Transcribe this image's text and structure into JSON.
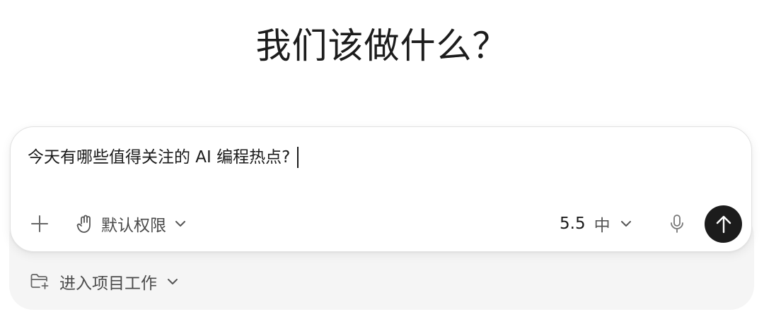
{
  "heading": "我们该做什么？",
  "composer": {
    "input_text": "今天有哪些值得关注的 AI 编程热点?",
    "permission_label": "默认权限",
    "model_version": "5.5",
    "model_level": "中"
  },
  "project": {
    "label": "进入项目工作"
  },
  "icons": {
    "plus": "plus-icon",
    "permission": "hand-icon",
    "model_dropdown": "chevron-down-icon",
    "mic": "microphone-icon",
    "send": "arrow-up-icon",
    "project": "folder-plus-icon"
  },
  "colors": {
    "send_button": "#1c1c1c",
    "tray_background": "#f5f5f5"
  }
}
